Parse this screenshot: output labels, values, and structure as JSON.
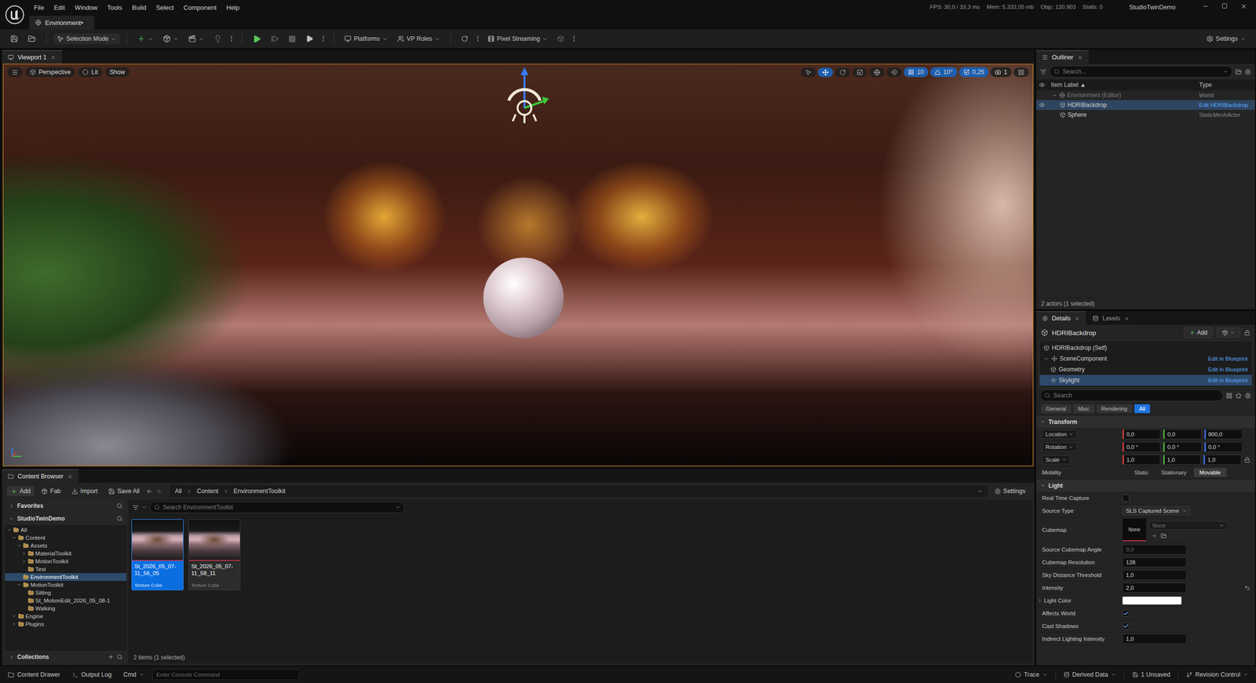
{
  "window": {
    "stats": [
      "FPS: 30,0 / 33,3 ms",
      "Mem: 5.332,05 mb",
      "Objs: 120.903",
      "Stalls: 0"
    ],
    "project": "StudioTwinDemo"
  },
  "menu": [
    "File",
    "Edit",
    "Window",
    "Tools",
    "Build",
    "Select",
    "Component",
    "Help"
  ],
  "level_tab": {
    "label": "Envrionment•"
  },
  "toolbar": {
    "selection_mode": "Selection Mode",
    "dropdowns": [
      "Platforms",
      "VP Roles",
      "Pixel Streaming"
    ],
    "settings": "Settings"
  },
  "viewport": {
    "tab": "Viewport 1",
    "view_buttons": [
      "Perspective",
      "Lit",
      "Show"
    ],
    "snap_values": [
      "10",
      "10°",
      "0,25",
      "1"
    ]
  },
  "outliner": {
    "tab": "Outliner",
    "search_placeholder": "Search...",
    "columns": [
      "Item Label ▲",
      "Type"
    ],
    "rows": [
      {
        "label": "Envrionment (Editor)",
        "type": "World",
        "greyed": true,
        "link": false,
        "selected": false,
        "expanded": true,
        "children": [
          {
            "label": "HDRIBackdrop",
            "type": "Edit HDRIBackdrop",
            "greyed": false,
            "link": true,
            "selected": true,
            "expanded": false,
            "children": []
          },
          {
            "label": "Sphere",
            "type": "StaticMeshActor",
            "greyed": false,
            "link": false,
            "selected": false,
            "expanded": false,
            "children": []
          }
        ]
      }
    ],
    "footer": "2 actors (1 selected)"
  },
  "details": {
    "tabs": [
      {
        "label": "Details",
        "selected": true
      },
      {
        "label": "Levels",
        "selected": false
      }
    ],
    "actor": "HDRIBackdrop",
    "add": "Add",
    "components": [
      {
        "label": "HDRIBackdrop (Self)",
        "link": "",
        "selected": false,
        "expanded": false,
        "children": []
      },
      {
        "label": "SceneComponent",
        "link": "Edit in Blueprint",
        "selected": false,
        "expanded": true,
        "children": [
          {
            "label": "Geometry",
            "link": "Edit in Blueprint",
            "selected": false,
            "expanded": false,
            "children": []
          },
          {
            "label": "Skylight",
            "link": "Edit in Blueprint",
            "selected": true,
            "expanded": false,
            "children": []
          }
        ]
      }
    ],
    "search_placeholder": "Search",
    "filters": [
      {
        "label": "General",
        "selected": false
      },
      {
        "label": "Misc",
        "selected": false
      },
      {
        "label": "Rendering",
        "selected": false
      },
      {
        "label": "All",
        "selected": true
      }
    ],
    "sections": [
      {
        "title": "Transform",
        "expanded": true,
        "rows": [
          {
            "kind": "vector",
            "label": "Location",
            "values": [
              "0,0",
              "0,0",
              "800,0"
            ],
            "locked": false
          },
          {
            "kind": "vector",
            "label": "Rotation",
            "values": [
              "0,0 °",
              "0,0 °",
              "0,0 °"
            ],
            "locked": false
          },
          {
            "kind": "vector",
            "label": "Scale",
            "values": [
              "1,0",
              "1,0",
              "1,0"
            ],
            "locked": true
          },
          {
            "kind": "segmented",
            "label": "Mobility",
            "options": [
              {
                "label": "Static",
                "selected": false
              },
              {
                "label": "Stationary",
                "selected": false
              },
              {
                "label": "Movable",
                "selected": true
              }
            ]
          }
        ]
      },
      {
        "title": "Light",
        "expanded": true,
        "rows": [
          {
            "kind": "checkbox",
            "label": "Real Time Capture",
            "checked": false
          },
          {
            "kind": "dropdown",
            "label": "Source Type",
            "value": "SLS Captured Scene"
          },
          {
            "kind": "asset",
            "label": "Cubemap",
            "thumb": "None",
            "value": "None"
          },
          {
            "kind": "number",
            "label": "Source Cubemap Angle",
            "value": "0,0",
            "disabled": true,
            "reset": false
          },
          {
            "kind": "number",
            "label": "Cubemap Resolution",
            "value": "128",
            "disabled": false,
            "reset": false
          },
          {
            "kind": "number",
            "label": "Sky Distance Threshold",
            "value": "1,0",
            "disabled": false,
            "reset": false
          },
          {
            "kind": "number",
            "label": "Intensity",
            "value": "2,0",
            "disabled": false,
            "reset": true
          },
          {
            "kind": "color",
            "label": "Light Color",
            "color": "#ffffff",
            "expandable": true
          },
          {
            "kind": "checkbox",
            "label": "Affects World",
            "checked": true
          },
          {
            "kind": "checkbox",
            "label": "Cast Shadows",
            "checked": true
          },
          {
            "kind": "number",
            "label": "Indirect Lighting Intensity",
            "value": "1,0",
            "disabled": false,
            "reset": false
          }
        ]
      }
    ]
  },
  "content_browser": {
    "tab": "Content Browser",
    "actions": [
      "Add",
      "Fab",
      "Import",
      "Save All"
    ],
    "breadcrumb": [
      "All",
      "Content",
      "EnvironmentToolkit"
    ],
    "settings": "Settings",
    "favorites": "Favorites",
    "project": "StudioTwinDemo",
    "tree": [
      {
        "label": "All",
        "expandable": true,
        "expanded": true,
        "selected": false,
        "children": [
          {
            "label": "Content",
            "expandable": true,
            "expanded": true,
            "selected": false,
            "children": [
              {
                "label": "Assets",
                "expandable": true,
                "expanded": true,
                "selected": false,
                "children": [
                  {
                    "label": "MaterialToolkit",
                    "expandable": true,
                    "expanded": false,
                    "selected": false,
                    "children": []
                  },
                  {
                    "label": "MotionToolkit",
                    "expandable": true,
                    "expanded": false,
                    "selected": false,
                    "children": []
                  },
                  {
                    "label": "Test",
                    "expandable": false,
                    "expanded": false,
                    "selected": false,
                    "children": []
                  }
                ]
              },
              {
                "label": "EnvironmentToolkit",
                "expandable": false,
                "expanded": false,
                "selected": true,
                "children": []
              },
              {
                "label": "MotionToolkit",
                "expandable": true,
                "expanded": true,
                "selected": false,
                "children": [
                  {
                    "label": "Sitting",
                    "expandable": false,
                    "expanded": false,
                    "selected": false,
                    "children": []
                  },
                  {
                    "label": "St_MotionEdit_2026_05_08-1",
                    "expandable": false,
                    "expanded": false,
                    "selected": false,
                    "children": []
                  },
                  {
                    "label": "Walking",
                    "expandable": false,
                    "expanded": false,
                    "selected": false,
                    "children": []
                  }
                ]
              }
            ]
          },
          {
            "label": "Engine",
            "expandable": true,
            "expanded": false,
            "selected": false,
            "children": []
          },
          {
            "label": "Plugins",
            "expandable": true,
            "expanded": false,
            "selected": false,
            "children": []
          }
        ]
      }
    ],
    "search_placeholder": "Search EnvironmentToolkit",
    "assets": [
      {
        "name": "St_2026_05_07-11_56_05",
        "type": "Texture Cube",
        "selected": true
      },
      {
        "name": "St_2026_05_07-11_58_11",
        "type": "Texture Cube",
        "selected": false
      }
    ],
    "count": "2 items (1 selected)",
    "collections": "Collections"
  },
  "status_bar": {
    "left": [
      "Content Drawer",
      "Output Log"
    ],
    "cmd": "Cmd",
    "console_placeholder": "Enter Console Command",
    "right": [
      "Trace",
      "Derived Data",
      "1 Unsaved",
      "Revision Control"
    ]
  }
}
